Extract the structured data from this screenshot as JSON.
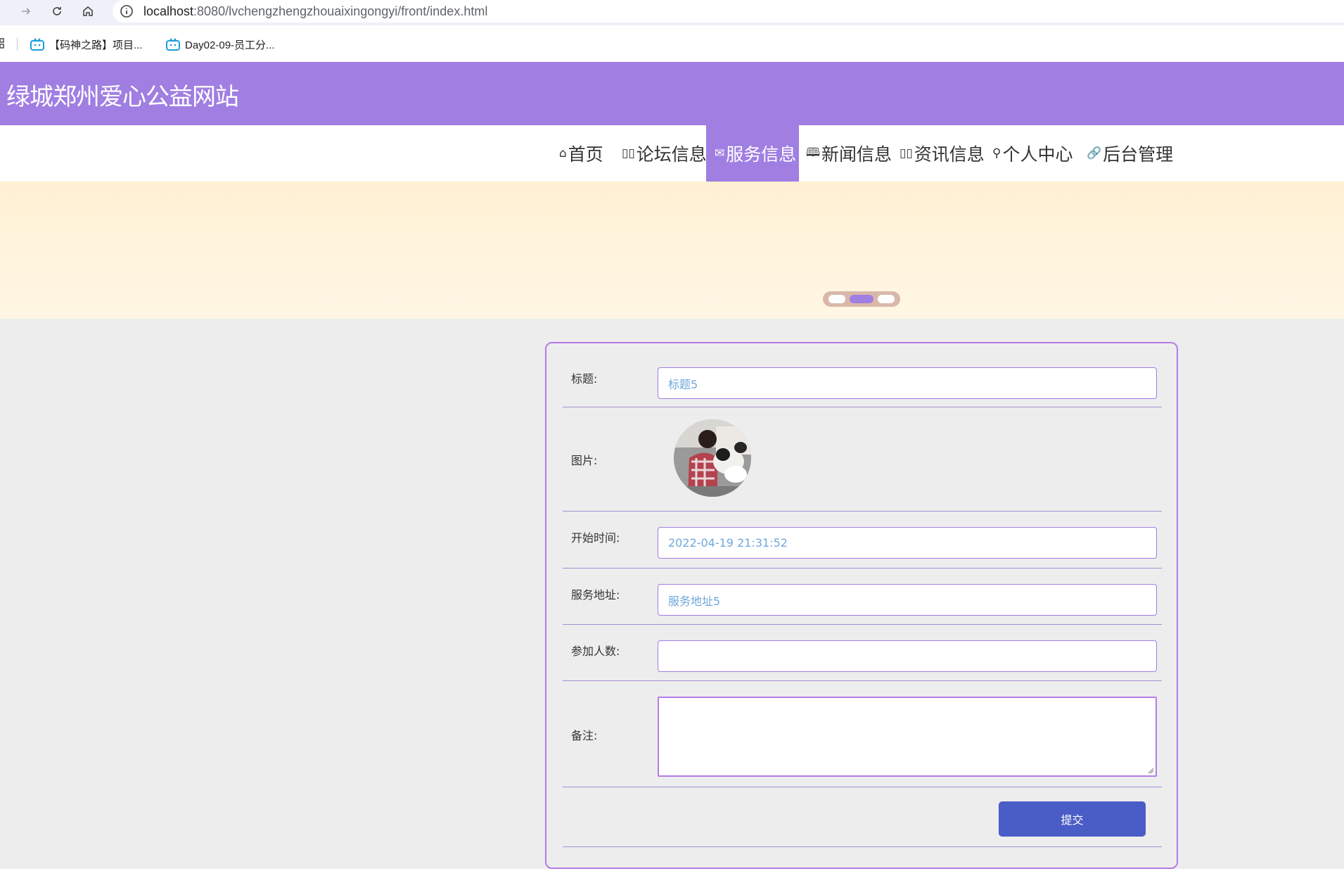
{
  "browser": {
    "url_host": "localhost",
    "url_path": ":8080/lvchengzhengzhouaixingongyi/front/index.html",
    "bookmarks": [
      {
        "label": "【码神之路】项目..."
      },
      {
        "label": "Day02-09-员工分..."
      }
    ]
  },
  "site": {
    "title": "绿城郑州爱心公益网站"
  },
  "nav": {
    "items": [
      {
        "icon": "⌂",
        "label": "首页"
      },
      {
        "icon": "▯▯",
        "label": "论坛信息"
      },
      {
        "icon": "✉",
        "label": "服务信息"
      },
      {
        "icon": "🕮",
        "label": "新闻信息"
      },
      {
        "icon": "▯▯",
        "label": "资讯信息"
      },
      {
        "icon": "⚲",
        "label": "个人中心"
      },
      {
        "icon": "🔗",
        "label": "后台管理"
      }
    ],
    "active_index": 2
  },
  "banner": {
    "dots": 3,
    "active_dot": 1
  },
  "form": {
    "title_label": "标题:",
    "title_value": "标题5",
    "image_label": "图片:",
    "start_time_label": "开始时间:",
    "start_time_value": "2022-04-19 21:31:52",
    "address_label": "服务地址:",
    "address_value": "服务地址5",
    "participants_label": "参加人数:",
    "participants_value": "",
    "remark_label": "备注:",
    "remark_value": "",
    "submit_label": "提交"
  },
  "colors": {
    "accent": "#a07ee2",
    "submit": "#4a5cc5",
    "value_text": "#6fa8dc"
  }
}
